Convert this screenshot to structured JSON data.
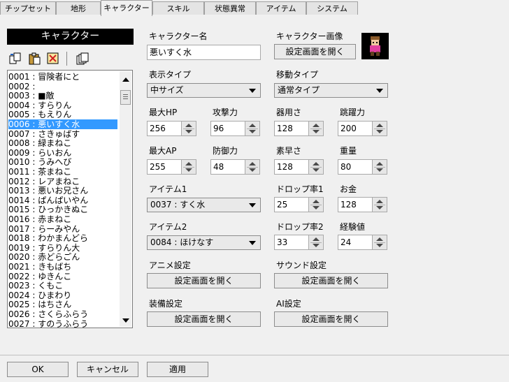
{
  "tabs": [
    "チップセット",
    "地形",
    "キャラクター",
    "スキル",
    "状態異常",
    "アイテム",
    "システム"
  ],
  "list": {
    "title": "キャラクター",
    "items": [
      "0001 : 冒険者にと",
      "0002 :",
      "0003 : ■敵",
      "0004 : すらりん",
      "0005 : もえりん",
      "0006 : 悪いすく水",
      "0007 : さきゅばす",
      "0008 : 緑まねこ",
      "0009 : らいおん",
      "0010 : うみへび",
      "0011 : 茶まねこ",
      "0012 : レアまねこ",
      "0013 : 悪いお兄さん",
      "0014 : ぱんぱいやん",
      "0015 : ひっかきぬこ",
      "0016 : 赤まねこ",
      "0017 : らーみやん",
      "0018 : わかまんどら",
      "0019 : すらりん大",
      "0020 : 赤どらごん",
      "0021 : きもばち",
      "0022 : ゆきんこ",
      "0023 : くもこ",
      "0024 : ひまわり",
      "0025 : はちさん",
      "0026 : さくらふらう",
      "0027 : すのうふらう"
    ],
    "selected_index": 5
  },
  "form": {
    "name_label": "キャラクター名",
    "name_value": "悪いすく水",
    "image_label": "キャラクター画像",
    "open_settings": "設定画面を開く",
    "display_type_label": "表示タイプ",
    "display_type_value": "中サイズ",
    "move_type_label": "移動タイプ",
    "move_type_value": "通常タイプ",
    "max_hp_label": "最大HP",
    "max_hp": "256",
    "attack_label": "攻撃力",
    "attack": "96",
    "dexterity_label": "器用さ",
    "dexterity": "128",
    "jump_label": "跳躍力",
    "jump": "200",
    "max_ap_label": "最大AP",
    "max_ap": "255",
    "defense_label": "防御力",
    "defense": "48",
    "agility_label": "素早さ",
    "agility": "128",
    "weight_label": "重量",
    "weight": "80",
    "item1_label": "アイテム1",
    "item1_value": "0037 : すく水",
    "drop1_label": "ドロップ率1",
    "drop1": "25",
    "money_label": "お金",
    "money": "128",
    "item2_label": "アイテム2",
    "item2_value": "0084 : ほけなす",
    "drop2_label": "ドロップ率2",
    "drop2": "33",
    "exp_label": "経験値",
    "exp": "24",
    "anime_label": "アニメ設定",
    "sound_label": "サウンド設定",
    "equip_label": "装備設定",
    "ai_label": "AI設定"
  },
  "bottom": {
    "ok": "OK",
    "cancel": "キャンセル",
    "apply": "適用"
  }
}
